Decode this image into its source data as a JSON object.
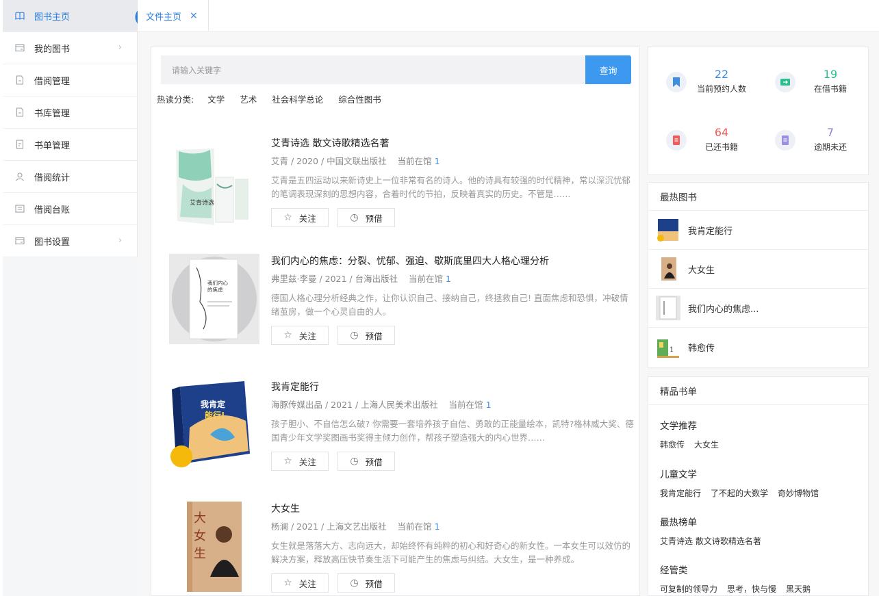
{
  "sidebar": {
    "items": [
      {
        "label": "图书主页",
        "icon": "book-open-icon",
        "active": true
      },
      {
        "label": "我的图书",
        "icon": "folder-icon",
        "arrow": true
      },
      {
        "label": "借阅管理",
        "icon": "document-icon"
      },
      {
        "label": "书库管理",
        "icon": "document-icon"
      },
      {
        "label": "书单管理",
        "icon": "list-doc-icon"
      },
      {
        "label": "借阅统计",
        "icon": "users-icon"
      },
      {
        "label": "借阅台账",
        "icon": "ledger-icon"
      },
      {
        "label": "图书设置",
        "icon": "folder-icon",
        "arrow": true
      }
    ]
  },
  "tabs": {
    "active_label": "文件主页",
    "close_symbol": "×"
  },
  "search": {
    "placeholder": "请输入关键字",
    "button_label": "查询"
  },
  "hot_categories": {
    "label": "热读分类:",
    "items": [
      "文学",
      "艺术",
      "社会科学总论",
      "综合性图书"
    ]
  },
  "books": [
    {
      "title": "艾青诗选 散文诗歌精选名著",
      "meta": "艾青 / 2020 / 中国文联出版社",
      "status": "当前在馆",
      "count": "1",
      "desc": "艾青是五四运动以来新诗史上一位非常有名的诗人。他的诗具有较强的时代精神，常以深沉忧郁的笔调表现深刻的思想内容，合着时代的节拍，反映着真实的历史。不管是……",
      "follow": "关注",
      "borrow": "预借"
    },
    {
      "title": "我们内心的焦虑：分裂、忧郁、强迫、歇斯底里四大人格心理分析",
      "meta": "弗里兹·李曼 / 2021 / 台海出版社",
      "status": "当前在馆",
      "count": "1",
      "desc": "德国人格心理分析经典之作，让你认识自己、接纳自己，终拯救自己! 直面焦虑和恐惧，冲破情绪茧房，做一个心灵自由的人。",
      "follow": "关注",
      "borrow": "预借"
    },
    {
      "title": "我肯定能行",
      "meta": "海豚传媒出品 / 2021 / 上海人民美术出版社",
      "status": "当前在馆",
      "count": "1",
      "desc": "孩子胆小、不自信怎么破? 你需要一套培养孩子自信、勇敢的正能量绘本，凯特?格林威大奖、德国青少年文学奖图画书奖得主倾力创作，帮孩子塑造强大的内心世界……",
      "follow": "关注",
      "borrow": "预借"
    },
    {
      "title": "大女生",
      "meta": "杨澜 / 2021 / 上海文艺出版社",
      "status": "当前在馆",
      "count": "1",
      "desc": "女生就是落落大方、志向远大，却始终怀有纯粹的初心和好奇心的新女性。一本女生可以效仿的解决方案，释放高压快节奏生活下可能产生的焦虑与纠结。大女生，是一种养成。",
      "follow": "关注",
      "borrow": "预借"
    }
  ],
  "stats": [
    {
      "value": "22",
      "label": "当前预约人数",
      "color": "#3d8ee0",
      "icon": "bookmark-icon",
      "icon_color": "#3d8ee0"
    },
    {
      "value": "19",
      "label": "在借书籍",
      "color": "#2bbf8c",
      "icon": "book-transfer-icon",
      "icon_color": "#2bbf8c"
    },
    {
      "value": "64",
      "label": "已还书籍",
      "color": "#ef5b5b",
      "icon": "book-return-icon",
      "icon_color": "#ef5b5b"
    },
    {
      "value": "7",
      "label": "逾期未还",
      "color": "#8b7fd6",
      "icon": "book-overdue-icon",
      "icon_color": "#9d8fe0"
    }
  ],
  "hot_books": {
    "title": "最热图书",
    "items": [
      "我肯定能行",
      "大女生",
      "我们内心的焦虑...",
      "韩愈传"
    ]
  },
  "booklists": {
    "title": "精品书单",
    "sections": [
      {
        "title": "文学推荐",
        "items": [
          "韩愈传",
          "大女生"
        ]
      },
      {
        "title": "儿童文学",
        "items": [
          "我肯定能行",
          "了不起的大数学",
          "奇妙博物馆"
        ]
      },
      {
        "title": "最热榜单",
        "items": [
          "艾青诗选 散文诗歌精选名著"
        ]
      },
      {
        "title": "经管类",
        "items": [
          "可复制的领导力",
          "思考，快与慢",
          "黑天鹅"
        ]
      }
    ]
  },
  "colors": {
    "accent": "#3d98f0",
    "sidebar_active_bg": "#e8eaee"
  }
}
